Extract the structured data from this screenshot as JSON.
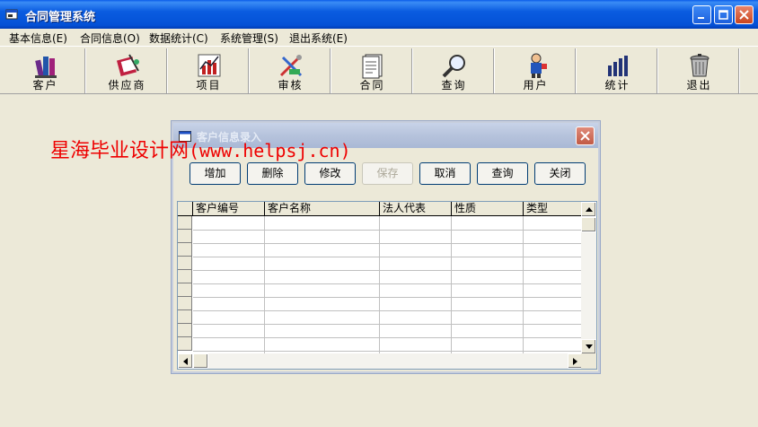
{
  "window": {
    "title": "合同管理系统"
  },
  "menu": [
    "基本信息(E)",
    "合同信息(O)",
    "数据统计(C)",
    "系统管理(S)",
    "退出系统(E)"
  ],
  "toolbar": [
    {
      "label": "客户",
      "icon": "books-icon"
    },
    {
      "label": "供应商",
      "icon": "supplier-icon"
    },
    {
      "label": "项目",
      "icon": "chart-bars-icon"
    },
    {
      "label": "审核",
      "icon": "tools-icon"
    },
    {
      "label": "合同",
      "icon": "document-icon"
    },
    {
      "label": "查询",
      "icon": "magnifier-icon"
    },
    {
      "label": "用户",
      "icon": "user-icon"
    },
    {
      "label": "统计",
      "icon": "stats-icon"
    },
    {
      "label": "退出",
      "icon": "trash-icon"
    }
  ],
  "watermark": {
    "cn": "星海毕业设计网",
    "url": "(www.helpsj.cn)"
  },
  "dialog": {
    "title": "客户信息录入",
    "buttons": [
      {
        "label": "增加",
        "enabled": true
      },
      {
        "label": "删除",
        "enabled": true
      },
      {
        "label": "修改",
        "enabled": true
      },
      {
        "label": "保存",
        "enabled": false
      },
      {
        "label": "取消",
        "enabled": true
      },
      {
        "label": "查询",
        "enabled": true
      },
      {
        "label": "关闭",
        "enabled": true
      }
    ],
    "columns": [
      "客户编号",
      "客户名称",
      "法人代表",
      "性质",
      "类型"
    ]
  }
}
